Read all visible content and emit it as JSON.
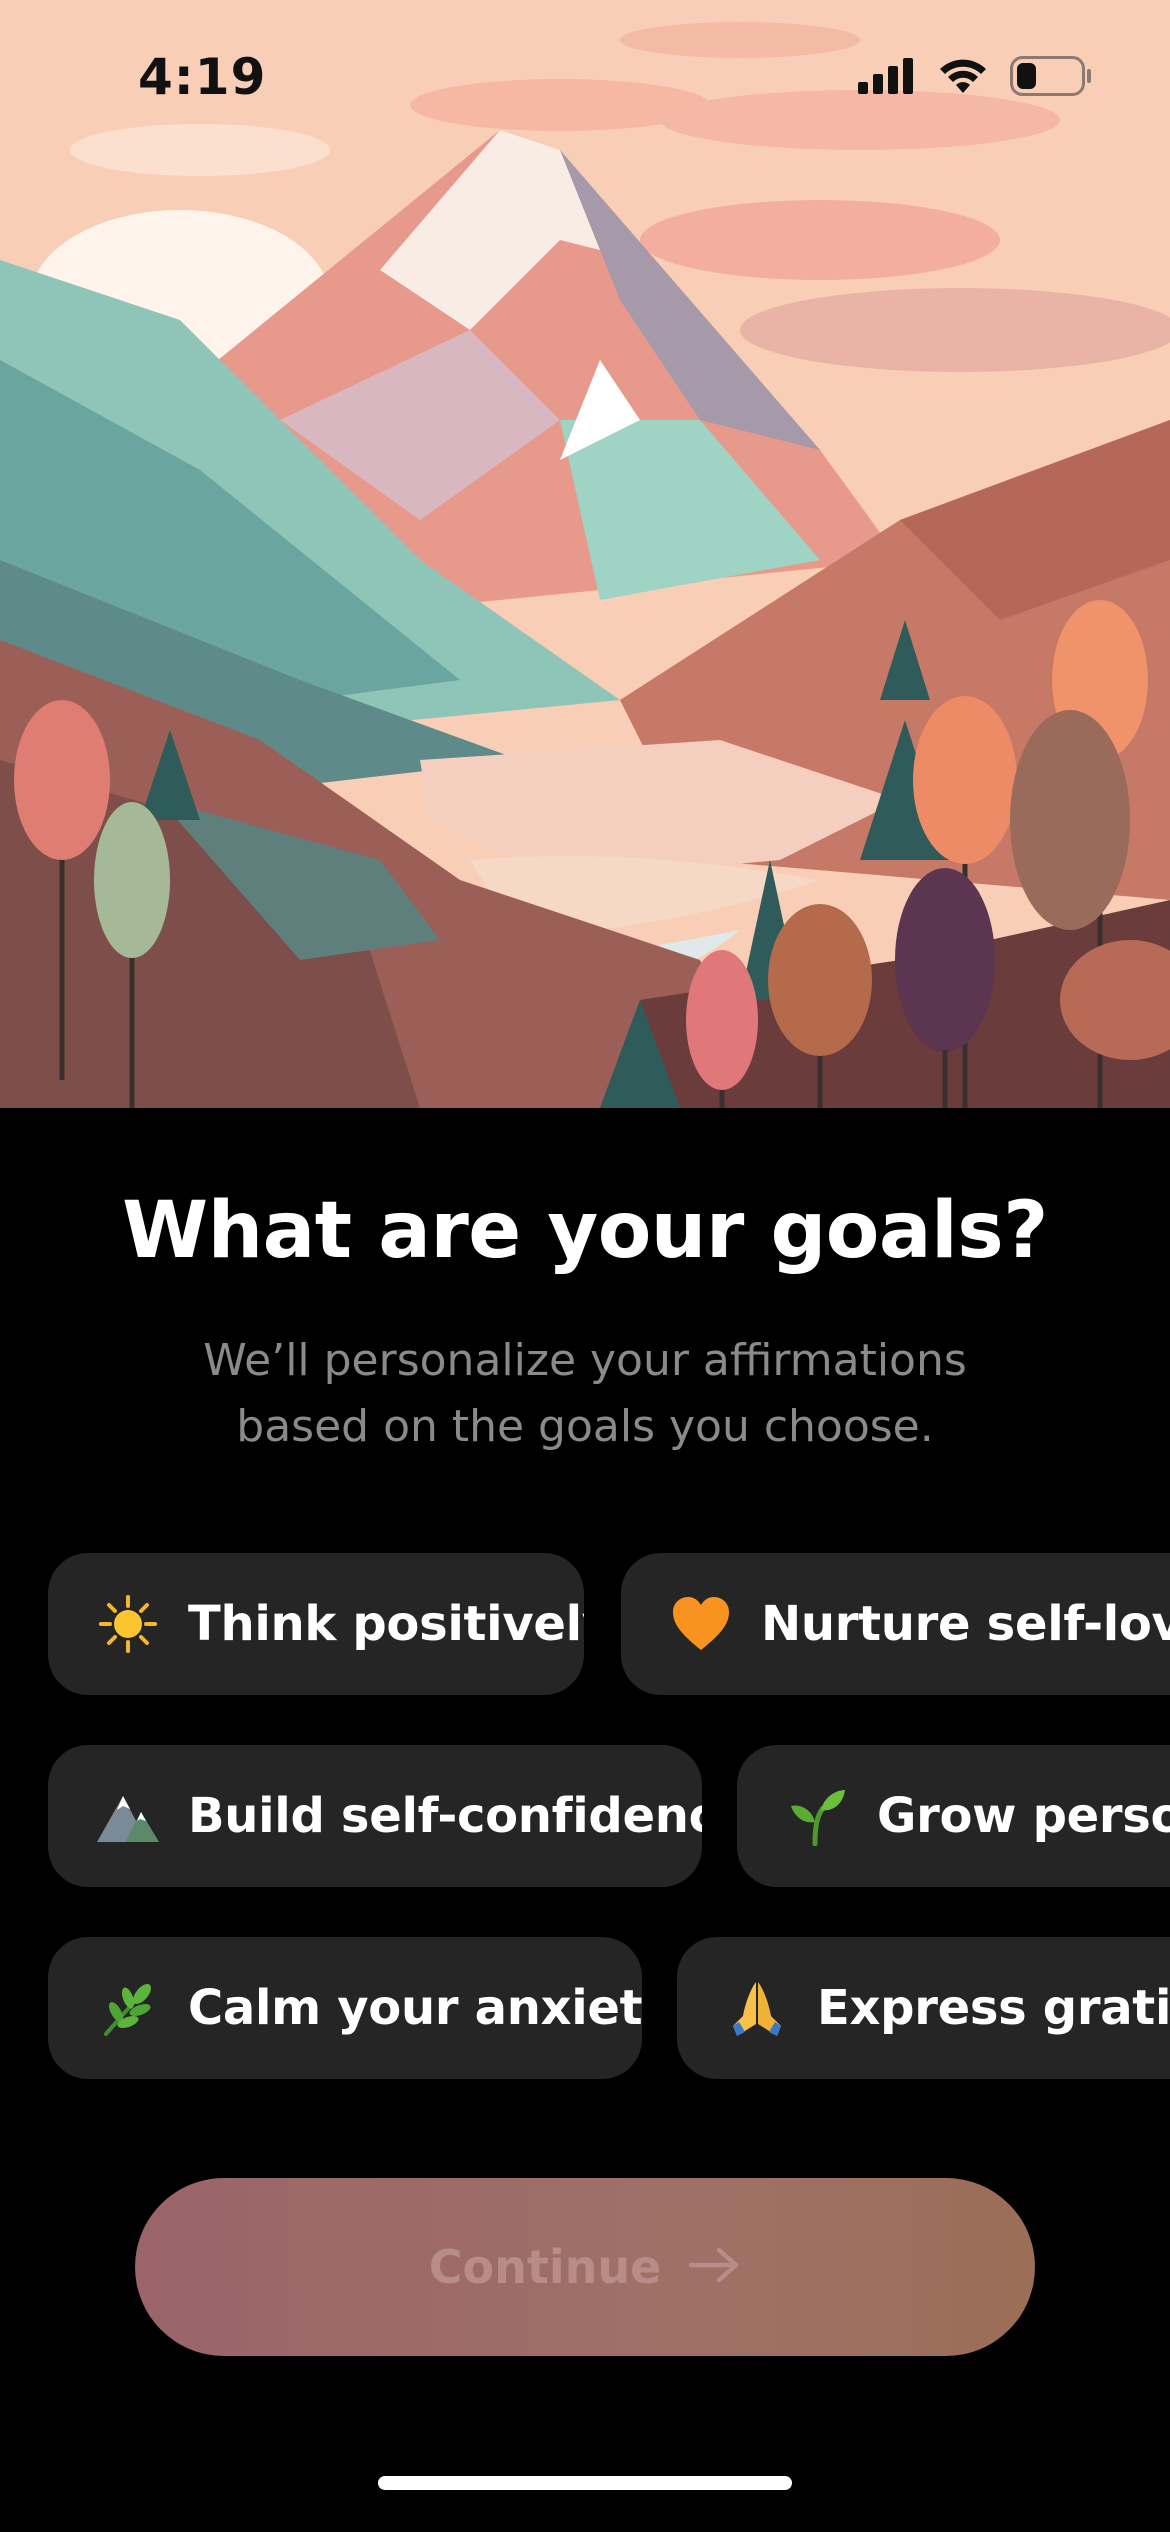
{
  "status_bar": {
    "time": "4:19",
    "icons": [
      "signal-icon",
      "wifi-icon",
      "battery-icon"
    ],
    "battery_level": 0.3
  },
  "hero": {
    "illustration": "mountain-landscape"
  },
  "title": "What are your goals?",
  "subtitle": {
    "line1": "We’ll personalize your affirmations",
    "line2": "based on the goals you choose."
  },
  "goals": [
    {
      "label": "Think positively",
      "icon": "sun-icon"
    },
    {
      "label": "Nurture self-love",
      "icon": "orange-heart-icon"
    },
    {
      "label": "Build self-confidence",
      "icon": "mountain-icon"
    },
    {
      "label": "Grow person",
      "icon": "seedling-icon"
    },
    {
      "label": "Calm your anxiety",
      "icon": "herb-icon"
    },
    {
      "label": "Express gratitud",
      "icon": "praying-hands-icon"
    }
  ],
  "continue_button": {
    "label": "Continue",
    "icon": "arrow-right-icon"
  },
  "colors": {
    "background": "#000000",
    "chip": "#252525",
    "subtitle": "#8a8a8a",
    "button_start": "#9a6469",
    "button_end": "#9b6e57"
  }
}
